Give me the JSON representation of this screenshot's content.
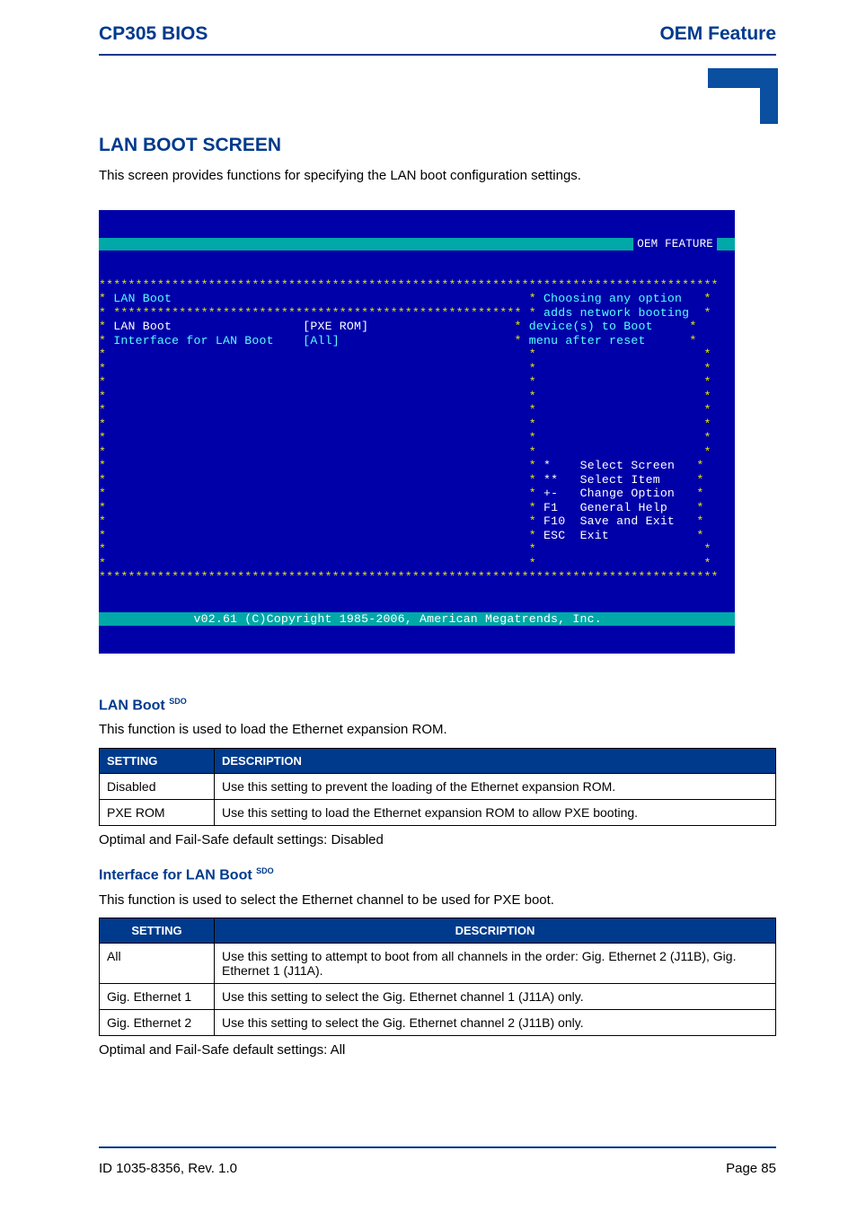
{
  "header": {
    "left": "CP305 BIOS",
    "right": "OEM Feature"
  },
  "section_title": "LAN BOOT SCREEN",
  "intro_text": "This screen provides functions for specifying the LAN boot configuration settings.",
  "bios": {
    "topbar_label": "OEM FEATURE",
    "title_item": "LAN Boot",
    "rows": [
      {
        "label": "LAN Boot",
        "value": "[PXE ROM]"
      },
      {
        "label": "Interface for LAN Boot",
        "value": "[All]"
      }
    ],
    "help_text": [
      "Choosing any option",
      "adds network booting",
      "device(s) to Boot",
      "menu after reset"
    ],
    "nav": [
      {
        "key": "*",
        "label": "Select Screen"
      },
      {
        "key": "**",
        "label": "Select Item"
      },
      {
        "key": "+-",
        "label": "Change Option"
      },
      {
        "key": "F1",
        "label": "General Help"
      },
      {
        "key": "F10",
        "label": "Save and Exit"
      },
      {
        "key": "ESC",
        "label": "Exit"
      }
    ],
    "footer": "v02.61 (C)Copyright 1985-2006, American Megatrends, Inc."
  },
  "lan_boot": {
    "heading": "LAN Boot",
    "sup": "SDO",
    "desc": "This function is used to load the Ethernet expansion ROM.",
    "col_setting": "SETTING",
    "col_desc": "DESCRIPTION",
    "rows": [
      {
        "setting": "Disabled",
        "desc": "Use this setting to prevent the loading of the Ethernet expansion ROM."
      },
      {
        "setting": "PXE ROM",
        "desc": "Use this setting to load the Ethernet expansion ROM to allow PXE booting."
      }
    ],
    "default_note": "Optimal and Fail-Safe default settings: Disabled"
  },
  "interface": {
    "heading": "Interface for LAN Boot",
    "sup": "SDO",
    "desc": "This function is used to select the Ethernet channel to be used for PXE boot.",
    "col_setting": "SETTING",
    "col_desc": "DESCRIPTION",
    "rows": [
      {
        "setting": "All",
        "desc": "Use this setting to attempt to boot from all channels in the order: Gig. Ethernet 2 (J11B), Gig. Ethernet 1 (J11A)."
      },
      {
        "setting": "Gig. Ethernet 1",
        "desc": "Use this setting to select the Gig. Ethernet channel 1 (J11A) only."
      },
      {
        "setting": "Gig. Ethernet 2",
        "desc": "Use this setting to select the Gig. Ethernet channel 2 (J11B) only."
      }
    ],
    "default_note": "Optimal and Fail-Safe default settings: All"
  },
  "footer": {
    "doc_id": "ID 1035-8356, Rev. 1.0",
    "page": "Page 85"
  }
}
